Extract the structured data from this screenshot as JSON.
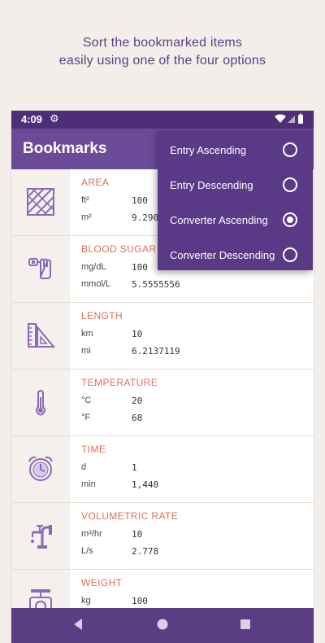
{
  "caption": {
    "line1": "Sort the bookmarked items",
    "line2": "easily using one of the four options"
  },
  "status": {
    "time": "4:09",
    "settings_icon": "gear-icon",
    "right_icons": [
      "wifi-icon",
      "cell-signal-icon",
      "battery-icon"
    ]
  },
  "appbar": {
    "title": "Bookmarks"
  },
  "bookmarks": [
    {
      "icon": "area-icon",
      "category": "AREA",
      "unit1": "ft²",
      "value1": "100",
      "unit2": "m²",
      "value2": "9.290"
    },
    {
      "icon": "blood-sugar-icon",
      "category": "BLOOD SUGAR",
      "unit1": "mg/dL",
      "value1": "100",
      "unit2": "mmol/L",
      "value2": "5.5555556"
    },
    {
      "icon": "length-icon",
      "category": "LENGTH",
      "unit1": "km",
      "value1": "10",
      "unit2": "mi",
      "value2": "6.2137119"
    },
    {
      "icon": "temperature-icon",
      "category": "TEMPERATURE",
      "unit1": "°C",
      "value1": "20",
      "unit2": "°F",
      "value2": "68"
    },
    {
      "icon": "time-icon",
      "category": "TIME",
      "unit1": "d",
      "value1": "1",
      "unit2": "min",
      "value2": "1,440"
    },
    {
      "icon": "volumetric-rate-icon",
      "category": "VOLUMETRIC RATE",
      "unit1": "m³/hr",
      "value1": "10",
      "unit2": "L/s",
      "value2": "2.778"
    },
    {
      "icon": "weight-icon",
      "category": "WEIGHT",
      "unit1": "kg",
      "value1": "100",
      "unit2": "",
      "value2": ""
    }
  ],
  "sort_menu": {
    "options": [
      {
        "label": "Entry Ascending",
        "selected": false
      },
      {
        "label": "Entry Descending",
        "selected": false
      },
      {
        "label": "Converter Ascending",
        "selected": true
      },
      {
        "label": "Converter Descending",
        "selected": false
      }
    ]
  },
  "navbar": {
    "buttons": [
      "back-icon",
      "home-icon",
      "recents-icon"
    ]
  },
  "colors": {
    "primary": "#6b4b98",
    "dark": "#4e2f77",
    "accent": "#e07055",
    "background": "#f3eeea"
  }
}
